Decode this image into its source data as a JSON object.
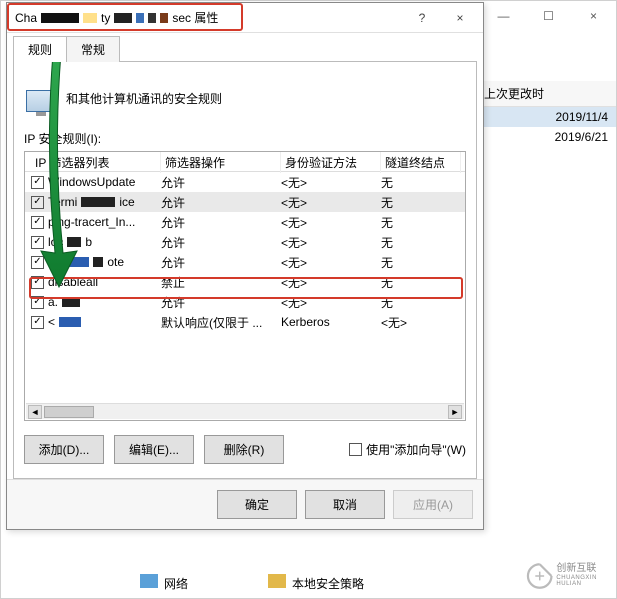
{
  "dialog": {
    "title_prefix": "Cha",
    "title_mid": "ty",
    "title_suffix": "sec 属性",
    "help_icon": "?",
    "close_icon": "×",
    "tabs": {
      "rules": "规则",
      "general": "常规"
    },
    "rule_desc": "和其他计算机通讯的安全规则",
    "section_label": "IP 安全规则(I):",
    "columns": {
      "filter_list": "IP 筛选器列表",
      "filter_action": "筛选器操作",
      "auth_method": "身份验证方法",
      "tunnel_endpoint": "隧道终结点"
    },
    "rows": [
      {
        "name": "WindowsUpdate",
        "obs": [],
        "action": "允许",
        "auth": "<无>",
        "endpoint": "无",
        "checked": true
      },
      {
        "name_parts": [
          "Termi",
          "OBS1",
          "ice"
        ],
        "action": "允许",
        "auth": "<无>",
        "endpoint": "无",
        "checked": true,
        "selected": true
      },
      {
        "name_parts": [
          "ping-tracert_In..."
        ],
        "action": "允许",
        "auth": "<无>",
        "endpoint": "无",
        "checked": true
      },
      {
        "name_parts": [
          "loc",
          "OBS2",
          "b"
        ],
        "action": "允许",
        "auth": "<无>",
        "endpoint": "无",
        "checked": true
      },
      {
        "name_parts": [
          "loc",
          "OBS3",
          "ote"
        ],
        "action": "允许",
        "auth": "<无>",
        "endpoint": "无",
        "checked": true
      },
      {
        "name_parts": [
          "disableall"
        ],
        "action": "禁止",
        "auth": "<无>",
        "endpoint": "无",
        "checked": true
      },
      {
        "name_parts": [
          "a.",
          "OBS4"
        ],
        "action": "允许",
        "auth": "<无>",
        "endpoint": "无",
        "checked": true
      },
      {
        "name_parts": [
          "<",
          "OBS5"
        ],
        "action": "默认响应(仅限于 ...",
        "auth": "Kerberos",
        "endpoint": "<无>",
        "checked": true
      }
    ],
    "buttons": {
      "add": "添加(D)...",
      "edit": "编辑(E)...",
      "remove": "删除(R)"
    },
    "wizard_check": "使用\"添加向导\"(W)",
    "ok": "确定",
    "cancel": "取消",
    "apply": "应用(A)"
  },
  "background": {
    "column_header": "上次更改时",
    "rows": [
      "2019/11/4",
      "2019/6/21"
    ],
    "footer_network": "网络",
    "footer_policy": "本地安全策略"
  },
  "logo": {
    "brand": "创新互联",
    "sub": "CHUANGXIN HULIAN"
  },
  "window_controls": {
    "min": "—",
    "max": "☐",
    "close": "×"
  }
}
